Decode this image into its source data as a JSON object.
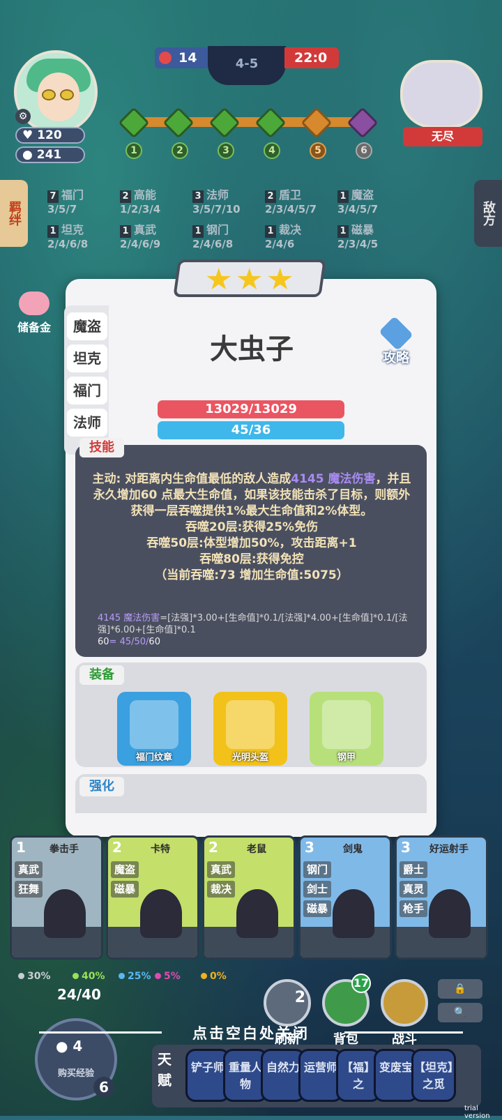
{
  "hud": {
    "player_hp": "120",
    "player_gold": "241",
    "left_score": "14",
    "round": "4-5",
    "right_score": "22:0",
    "stages": [
      "1",
      "2",
      "3",
      "4",
      "5",
      "6"
    ],
    "enemy_name": "无尽"
  },
  "side_tabs": {
    "left": "羁绊",
    "right": "敌方"
  },
  "synergies": [
    {
      "count": "7",
      "name": "福门",
      "levels": "3/5/7"
    },
    {
      "count": "2",
      "name": "高能",
      "levels": "1/2/3/4"
    },
    {
      "count": "3",
      "name": "法师",
      "levels": "3/5/7/10"
    },
    {
      "count": "2",
      "name": "盾卫",
      "levels": "2/3/4/5/7"
    },
    {
      "count": "1",
      "name": "魔盗",
      "levels": "3/4/5/7"
    },
    {
      "count": "1",
      "name": "坦克",
      "levels": "2/4/6/8"
    },
    {
      "count": "1",
      "name": "真武",
      "levels": "2/4/6/9"
    },
    {
      "count": "1",
      "name": "钢门",
      "levels": "2/4/6/8"
    },
    {
      "count": "1",
      "name": "裁决",
      "levels": "2/4/6"
    },
    {
      "count": "1",
      "name": "磁暴",
      "levels": "2/3/4/5"
    }
  ],
  "piggy_label": "储备金",
  "unit": {
    "name": "大虫子",
    "stars": 3,
    "tags": [
      "魔盗",
      "坦克",
      "福门",
      "法师"
    ],
    "guide_label": "攻略",
    "hp": "13029/13029",
    "mana": "45/36"
  },
  "skill": {
    "title": "技能",
    "line1_prefix": "主动: 对距离内生命值最低的敌人造成",
    "line1_highlight": "4145 魔法伤害",
    "line1_rest": "，并且永久增加60 点最大生命值，如果该技能击杀了目标，则额外获得一层吞噬提供1%最大生命值和2%体型。",
    "line2": "吞噬20层:获得25%免伤",
    "line3": "吞噬50层:体型增加50%，攻击距离+1",
    "line4": "吞噬80层:获得免控",
    "line5": "（当前吞噬:73 增加生命值:5075）",
    "formula1_hl": "4145 魔法伤害",
    "formula1": "=[法强]*3.00+[生命值]*0.1/[法强]*4.00+[生命值]*0.1/[法强]*6.00+[生命值]*0.1",
    "formula2_hl": "60",
    "formula2_mid": "= 45/50/",
    "formula2_end": "60"
  },
  "equipment": {
    "title": "装备",
    "items": [
      {
        "name": "福门纹章",
        "bg": "#3aa0e0"
      },
      {
        "name": "光明头盔",
        "bg": "#f2c21a"
      },
      {
        "name": "钢甲",
        "bg": "#b7e07a"
      }
    ]
  },
  "enhance_title": "强化",
  "shop": {
    "cards": [
      {
        "cost": "1",
        "name": "拳击手",
        "traits": [
          "真武",
          "狂舞"
        ],
        "color": "#9fb6c2"
      },
      {
        "cost": "2",
        "name": "卡特",
        "traits": [
          "魔盗",
          "磁暴"
        ],
        "color": "#c4df6a"
      },
      {
        "cost": "2",
        "name": "老鼠",
        "traits": [
          "真武",
          "裁决"
        ],
        "color": "#c4df6a"
      },
      {
        "cost": "3",
        "name": "剑鬼",
        "traits": [
          "钢门",
          "剑士",
          "磁暴"
        ],
        "color": "#7fb9e8"
      },
      {
        "cost": "3",
        "name": "好运射手",
        "traits": [
          "爵士",
          "真灵",
          "枪手"
        ],
        "color": "#7fb9e8"
      }
    ],
    "odds": [
      {
        "value": "30%",
        "color": "#c9ccd2"
      },
      {
        "value": "40%",
        "color": "#9ae05a"
      },
      {
        "value": "25%",
        "color": "#5ab7f0"
      },
      {
        "value": "5%",
        "color": "#e04ab0"
      },
      {
        "value": "0%",
        "color": "#f0b020"
      }
    ],
    "level": "24/40",
    "buy_xp_cost": "4",
    "buy_xp_label": "购买经验",
    "player_level": "6",
    "refresh_cost": "2",
    "refresh_label": "刷新",
    "bag_count": "17",
    "bag_label": "背包",
    "battle_label": "战斗"
  },
  "close_hint": "点击空白处关闭",
  "talent": {
    "label": "天赋",
    "items": [
      "铲子师",
      "重量人物",
      "自然力",
      "运营师",
      "【福】之",
      "变废宝",
      "【坦克】之觅"
    ]
  },
  "trial": "trial version"
}
